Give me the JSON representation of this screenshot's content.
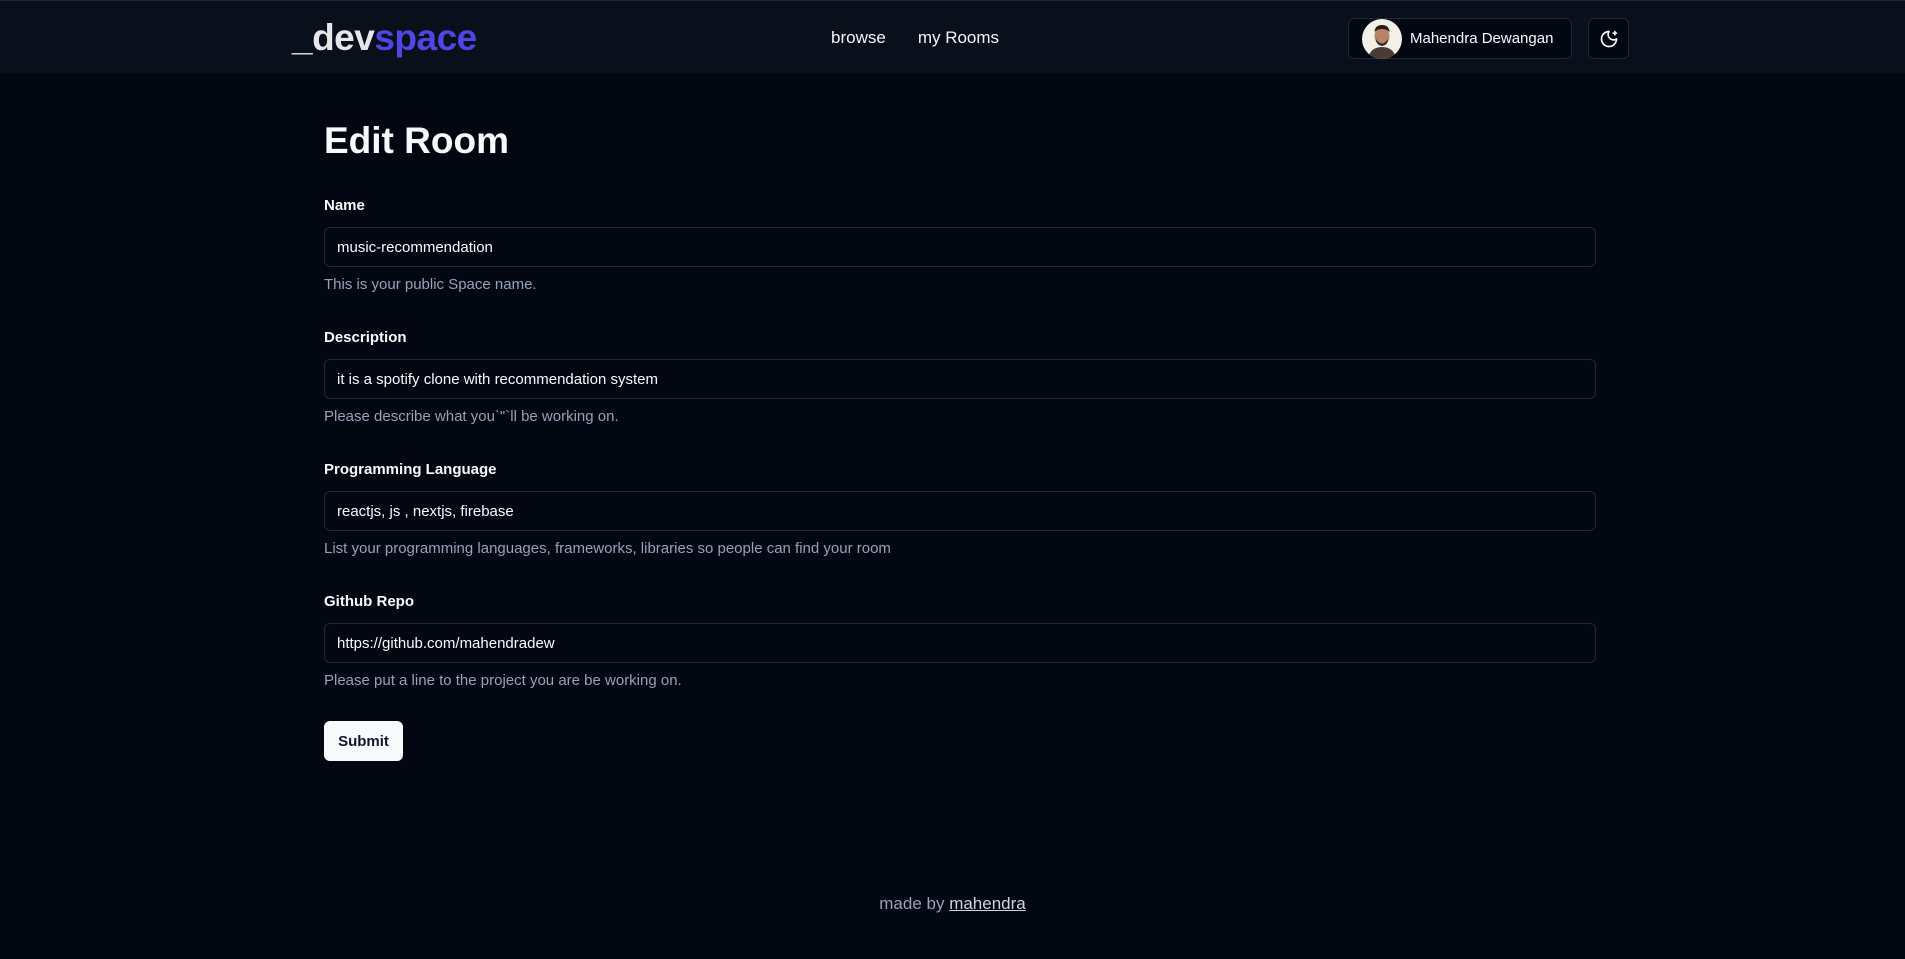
{
  "header": {
    "logo_prefix": "_dev",
    "logo_suffix": "space",
    "nav": [
      {
        "label": "browse"
      },
      {
        "label": "my Rooms"
      }
    ],
    "user": {
      "name": "Mahendra Dewangan",
      "avatar_icon": "avatar-photo"
    },
    "theme_toggle_icon": "moon-icon"
  },
  "main": {
    "title": "Edit Room",
    "fields": [
      {
        "label": "Name",
        "value": "music-recommendation",
        "hint": "This is your public Space name."
      },
      {
        "label": "Description",
        "value": "it is a spotify clone with recommendation system",
        "hint": "Please describe what you`\"`ll be working on."
      },
      {
        "label": "Programming Language",
        "value": "reactjs, js , nextjs, firebase",
        "hint": "List your programming languages, frameworks, libraries so people can find your room"
      },
      {
        "label": "Github Repo",
        "value": "https://github.com/mahendradew",
        "hint": "Please put a line to the project you are be working on."
      }
    ],
    "submit_label": "Submit"
  },
  "footer": {
    "prefix": "made by",
    "link": "mahendra"
  },
  "colors": {
    "background": "#030712",
    "header": "#0a0f1c",
    "accent": "#4f46e5",
    "muted_text": "#94a3b8"
  }
}
